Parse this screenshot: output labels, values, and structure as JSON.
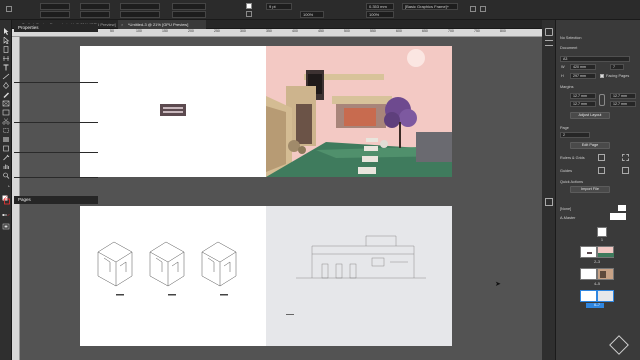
{
  "control_bar": {
    "font_size": "9 pt",
    "zoom": "100%",
    "stroke_weight": "0.353 mm",
    "frame_style": "[Basic Graphics Frame]+",
    "percent": "100%"
  },
  "tabs": [
    {
      "label": "Trello InDesign Example.indd @ 21% [GPU Preview]",
      "active": false
    },
    {
      "label": "*Untitled-3 @ 21% [GPU Preview]",
      "active": true
    }
  ],
  "ruler_ticks": [
    "100",
    "50",
    "0",
    "50",
    "100",
    "150",
    "200",
    "250",
    "300",
    "350",
    "400",
    "450",
    "500",
    "550",
    "600",
    "650",
    "700",
    "750",
    "800"
  ],
  "properties": {
    "title": "Properties",
    "selection": "No Selection",
    "document_label": "Document",
    "page_size": "A3",
    "width": "420 mm",
    "height": "297 mm",
    "pages_count": "7",
    "pages_field": "1",
    "facing_pages": "Facing Pages",
    "margins_label": "Margins",
    "margin_top": "12.7 mm",
    "margin_bottom": "12.7 mm",
    "margin_left": "12.7 mm",
    "margin_right": "12.7 mm",
    "adjust_layout": "Adjust Layout",
    "page_label": "Page",
    "page_value": "2",
    "edit_page": "Edit Page",
    "rulers_grids": "Rulers & Grids",
    "guides": "Guides",
    "quick_actions": "Quick Actions",
    "import_file": "Import File"
  },
  "pages_panel": {
    "title": "Pages",
    "none_label": "[None]",
    "master_label": "A-Master",
    "spreads": [
      {
        "label": "1"
      },
      {
        "label": "2–3"
      },
      {
        "label": "4–5"
      },
      {
        "label": "6–7"
      }
    ]
  }
}
